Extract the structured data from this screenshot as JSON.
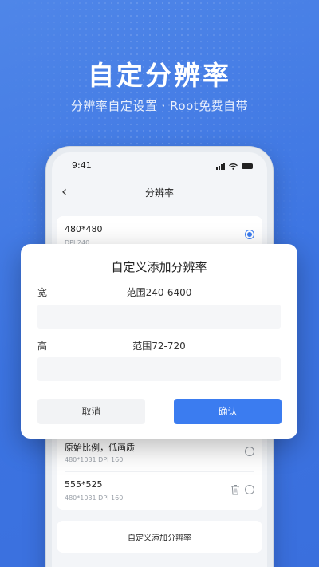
{
  "promo": {
    "headline": "自定分辨率",
    "subline": "分辨率自定设置 · Root免费自带"
  },
  "status_bar": {
    "time": "9:41"
  },
  "nav": {
    "title": "分辨率"
  },
  "resolutions": [
    {
      "name": "480*480",
      "detail": "DPI 240",
      "selected": true
    },
    {
      "name": "原始比例，低画质",
      "detail": "480*1031 DPI 160",
      "selected": false
    },
    {
      "name": "555*525",
      "detail": "480*1031 DPI 160",
      "selected": false,
      "deletable": true
    }
  ],
  "add_custom_label": "自定义添加分辨率",
  "dialog": {
    "title": "自定义添加分辨率",
    "width_label": "宽",
    "width_range": "范围240-6400",
    "width_value": "",
    "height_label": "高",
    "height_range": "范围72-720",
    "height_value": "",
    "cancel_label": "取消",
    "confirm_label": "确认"
  },
  "colors": {
    "accent": "#3b7cf0",
    "background": "#3c74e2"
  }
}
